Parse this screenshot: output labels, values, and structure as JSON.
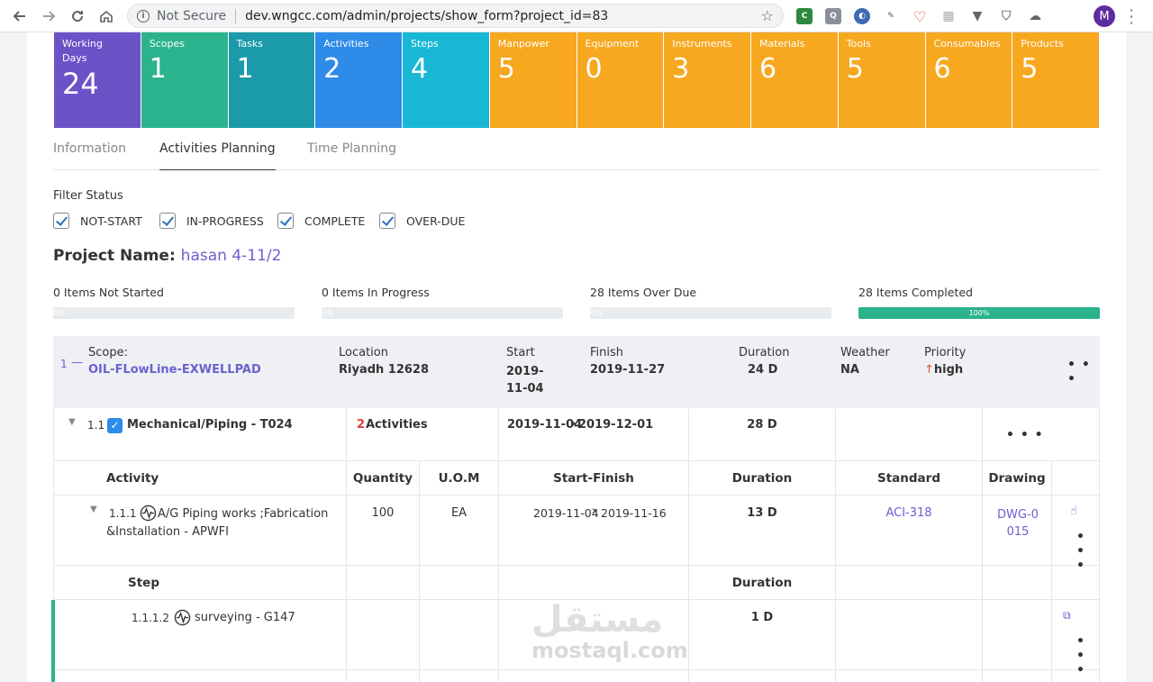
{
  "browser": {
    "security": "Not Secure",
    "url": "dev.wngcc.com/admin/projects/show_form?project_id=83",
    "avatar_initial": "M"
  },
  "stats": [
    {
      "label": "Working Days",
      "value": "24",
      "color": "#6c52c7"
    },
    {
      "label": "Scopes",
      "value": "1",
      "color": "#2bb38d"
    },
    {
      "label": "Tasks",
      "value": "1",
      "color": "#1a9aaa"
    },
    {
      "label": "Activities",
      "value": "2",
      "color": "#2e8be8"
    },
    {
      "label": "Steps",
      "value": "4",
      "color": "#19b7d6"
    },
    {
      "label": "Manpower",
      "value": "5",
      "color": "#f7a81f"
    },
    {
      "label": "Equipment",
      "value": "0",
      "color": "#f7a81f"
    },
    {
      "label": "Instruments",
      "value": "3",
      "color": "#f7a81f"
    },
    {
      "label": "Materials",
      "value": "6",
      "color": "#f7a81f"
    },
    {
      "label": "Tools",
      "value": "5",
      "color": "#f7a81f"
    },
    {
      "label": "Consumables",
      "value": "6",
      "color": "#f7a81f"
    },
    {
      "label": "Products",
      "value": "5",
      "color": "#f7a81f"
    }
  ],
  "tabs": [
    "Information",
    "Activities Planning",
    "Time Planning"
  ],
  "filter": {
    "label": "Filter Status",
    "options": [
      "NOT-START",
      "IN-PROGRESS",
      "COMPLETE",
      "OVER-DUE"
    ]
  },
  "project": {
    "label": "Project Name:",
    "name": "hasan 4-11/2"
  },
  "progress": [
    {
      "label": "0 Items Not Started",
      "percent": 0,
      "pct_label": "0%"
    },
    {
      "label": "0 Items In Progress",
      "percent": 0,
      "pct_label": "0%"
    },
    {
      "label": "28 Items Over Due",
      "percent": 0,
      "pct_label": "0%"
    },
    {
      "label": "28 Items Completed",
      "percent": 100,
      "pct_label": "100%"
    }
  ],
  "scope": {
    "index": "1",
    "toggle": "—",
    "scope_label": "Scope:",
    "scope_name": "OIL-FLowLine-EXWELLPAD",
    "location_label": "Location",
    "location": "Riyadh 12628",
    "start_label": "Start",
    "start": "2019-11-04",
    "finish_label": "Finish",
    "finish": "2019-11-27",
    "duration_label": "Duration",
    "duration": "24 D",
    "weather_label": "Weather",
    "weather": "NA",
    "priority_label": "Priority",
    "priority": "high",
    "menu": "• • •"
  },
  "task": {
    "index": "1.1",
    "name": "Mechanical/Piping - T024",
    "activities_count": "2",
    "activities_label": "Activities",
    "start": "2019-11-04",
    "end": "2019-12-01",
    "duration": "28 D",
    "menu": "• • •"
  },
  "activity_headers": [
    "Activity",
    "Quantity",
    "U.O.M",
    "Start-Finish",
    "Duration",
    "Standard",
    "Drawing"
  ],
  "activity": {
    "index": "1.1.1",
    "name": "A/G Piping works ;Fabrication &Installation - APWFI",
    "quantity": "100",
    "uom": "EA",
    "start": "2019-11-04",
    "end": "2019-11-16",
    "duration": "13 D",
    "standard": "ACI-318",
    "drawing": "DWG-0015",
    "menu": "• • •"
  },
  "step_headers": {
    "step": "Step",
    "duration": "Duration"
  },
  "step": {
    "index": "1.1.1.2",
    "name": "surveying - G147",
    "duration": "1 D",
    "menu": "• • •"
  },
  "watermark": {
    "arabic": "مستقل",
    "latin": "mostaql.com"
  }
}
